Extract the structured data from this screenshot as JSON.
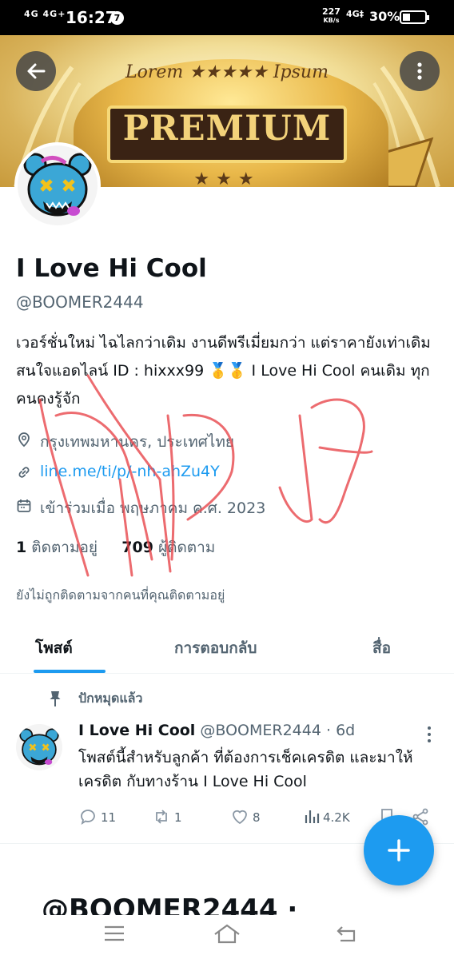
{
  "status_bar": {
    "signal": "4G 4G+",
    "time": "16:27",
    "notification_count": "7",
    "net_speed": "227",
    "net_unit": "KB/s",
    "network": "4G‡",
    "battery": "30%"
  },
  "banner": {
    "top_text": "Lorem ★★★★★ Ipsum",
    "main_text": "PREMIUM",
    "stars": "★★★"
  },
  "profile": {
    "name": "I Love Hi Cool",
    "handle": "@BOOMER2444",
    "bio": "เวอร์ชั่นใหม่ ไฉไลกว่าเดิม งานดีพรีเมี่ยมกว่า แต่ราคายังเท่าเดิม สนใจแอดไลน์ ID : hixxx99 🥇🥇 I Love Hi Cool คนเดิม ทุกคนคงรู้จัก",
    "location": "กรุงเทพมหานคร, ประเทศไทย",
    "link": "line.me/ti/p/-nh-ahZu4Y",
    "joined": "เข้าร่วมเมื่อ พฤษภาคม ค.ศ. 2023",
    "following_count": "1",
    "following_label": "ติดตามอยู่",
    "followers_count": "709",
    "followers_label": "ผู้ติดตาม",
    "not_followed_note": "ยังไม่ถูกติดตามจากคนที่คุณติดตามอยู่"
  },
  "tabs": [
    {
      "label": "โพสต์",
      "active": true
    },
    {
      "label": "การตอบกลับ",
      "active": false
    },
    {
      "label": "สื่อ",
      "active": false
    }
  ],
  "pinned_tweet": {
    "pinned_label": "ปักหมุดแล้ว",
    "author_name": "I Love Hi Cool",
    "author_handle": "@BOOMER2444",
    "time": "· 6d",
    "text": "โพสต์นี้สำหรับลูกค้า ที่ต้องการเช็คเครดิต และมาให้เครดิต กับทางร้าน I Love Hi Cool",
    "replies": "11",
    "retweets": "1",
    "likes": "8",
    "views": "4.2K"
  },
  "next_tweet_handle": "@BOOMER2444 ·",
  "colors": {
    "accent": "#1d9bf0",
    "text_primary": "#0f1419",
    "text_secondary": "#536471",
    "scribble": "#e8474c"
  },
  "icons": [
    "back-arrow-icon",
    "more-vertical-icon",
    "location-icon",
    "link-icon",
    "calendar-icon",
    "pin-icon",
    "reply-icon",
    "retweet-icon",
    "like-icon",
    "views-icon",
    "bookmark-icon",
    "share-icon",
    "compose-plus-icon",
    "menu-icon",
    "home-icon",
    "back-icon"
  ]
}
